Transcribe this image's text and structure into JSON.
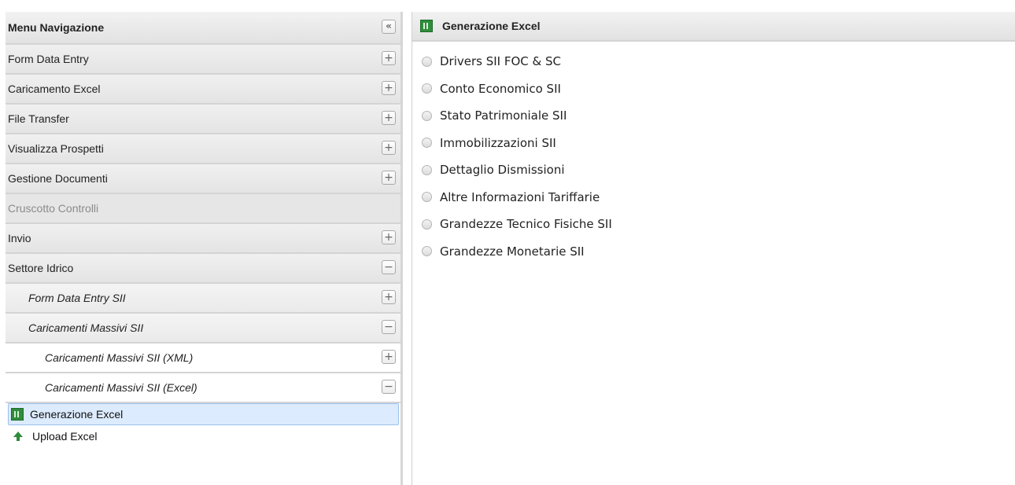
{
  "nav": {
    "title": "Menu Navigazione",
    "collapse_symbol": "«",
    "items": [
      {
        "label": "Form Data Entry",
        "toggle": "+"
      },
      {
        "label": "Caricamento Excel",
        "toggle": "+"
      },
      {
        "label": "File Transfer",
        "toggle": "+"
      },
      {
        "label": "Visualizza Prospetti",
        "toggle": "+"
      },
      {
        "label": "Gestione Documenti",
        "toggle": "+"
      },
      {
        "label": "Cruscotto Controlli"
      },
      {
        "label": "Invio",
        "toggle": "+"
      },
      {
        "label": "Settore Idrico",
        "toggle": "−"
      }
    ],
    "sub_items": [
      {
        "label": "Form Data Entry SII",
        "toggle": "+"
      },
      {
        "label": "Caricamenti Massivi SII",
        "toggle": "−"
      }
    ],
    "sub_sub_items": [
      {
        "label": "Caricamenti Massivi SII (XML)",
        "toggle": "+"
      },
      {
        "label": "Caricamenti Massivi SII (Excel)",
        "toggle": "−"
      }
    ],
    "leaves": [
      {
        "label": "Generazione Excel",
        "icon": "excel-icon",
        "selected": true
      },
      {
        "label": "Upload Excel",
        "icon": "upload-arrow-icon",
        "selected": false
      }
    ]
  },
  "content": {
    "title": "Generazione Excel",
    "icon": "excel-icon",
    "options": [
      "Drivers SII FOC & SC",
      "Conto Economico SII",
      "Stato Patrimoniale SII",
      "Immobilizzazioni SII",
      "Dettaglio Dismissioni",
      "Altre Informazioni Tariffarie",
      "Grandezze Tecnico Fisiche SII",
      "Grandezze Monetarie SII"
    ]
  },
  "colors": {
    "selected_bg": "#dcebfd",
    "selected_border": "#9dc1ec",
    "header_bg": "#e4e4e4",
    "excel_green": "#2f8d3c"
  }
}
